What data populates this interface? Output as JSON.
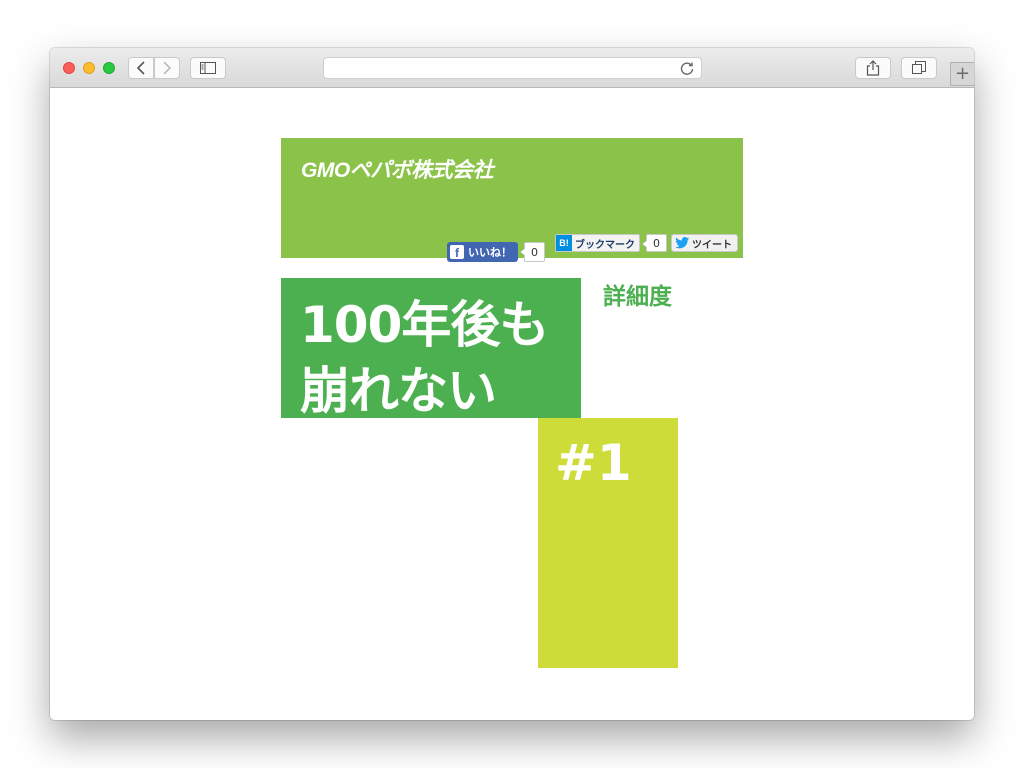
{
  "browser": {
    "address": "",
    "new_tab_label": "+"
  },
  "header": {
    "logo_text": "GMOペパボ株式会社",
    "background_color": "#8bc34a"
  },
  "social": {
    "facebook": {
      "label": "いいね！",
      "count": "0"
    },
    "hatena": {
      "icon_label": "B!",
      "label": "ブックマーク",
      "count": "0"
    },
    "twitter": {
      "label": "ツイート"
    }
  },
  "hero": {
    "line1": "100年後も",
    "line2": "崩れない",
    "background_color": "#4caf50"
  },
  "detail_label": "詳細度",
  "card": {
    "number": "#1",
    "background_color": "#cddc39"
  }
}
